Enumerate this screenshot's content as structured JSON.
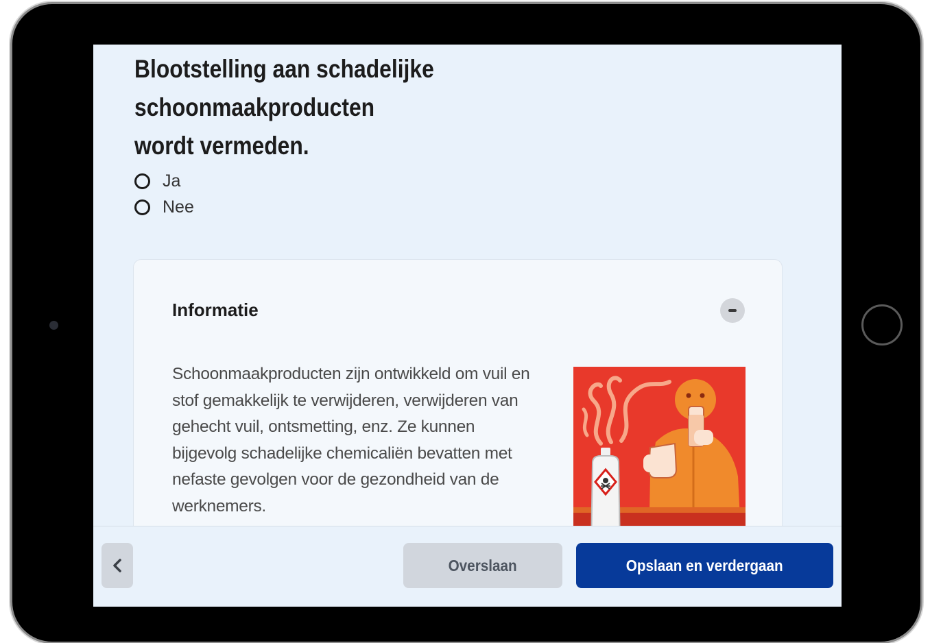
{
  "question": {
    "title": "Blootstelling aan schadelijke schoonmaakproducten\nwordt vermeden."
  },
  "options": [
    {
      "label": "Ja",
      "selected": false
    },
    {
      "label": "Nee",
      "selected": false
    }
  ],
  "info": {
    "title": "Informatie",
    "body": "Schoonmaakproducten zijn ontwikkeld om vuil en stof gemakkelijk te verwijderen, verwijderen van gehecht vuil, ontsmetting, enz. Ze kunnen bijgevolg schadelijke chemicaliën bevatten met nefaste gevolgen voor de gezondheid van de werknemers.",
    "collapse_icon": "minus-icon",
    "illustration": "worker-holding-glasses-with-toxic-cleaning-bottle"
  },
  "footer": {
    "back_icon": "chevron-left-icon",
    "skip_label": "Overslaan",
    "save_label": "Opslaan en verdergaan"
  },
  "colors": {
    "screen_bg": "#e9f2fb",
    "primary": "#073a9a",
    "secondary_button": "#d1d6dd",
    "illustration_red": "#e8392b",
    "illustration_orange": "#f08a2c"
  }
}
